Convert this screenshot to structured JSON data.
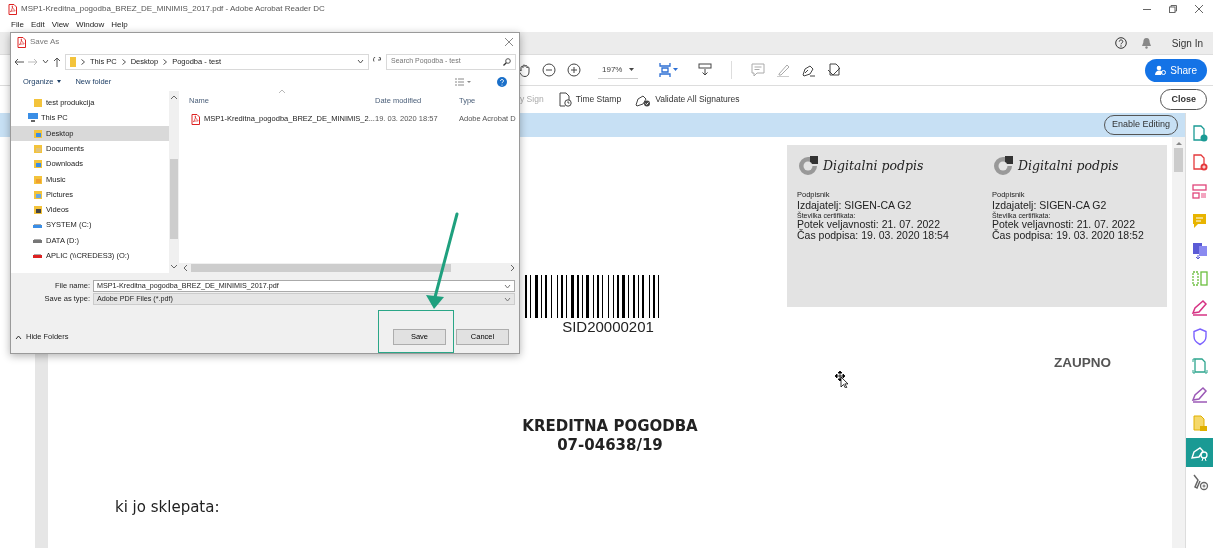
{
  "window": {
    "title": "MSP1-Kreditna_pogodba_BREZ_DE_MINIMIS_2017.pdf - Adobe Acrobat Reader DC"
  },
  "menu": [
    {
      "label": "File"
    },
    {
      "label": "Edit"
    },
    {
      "label": "View"
    },
    {
      "label": "Window"
    },
    {
      "label": "Help"
    }
  ],
  "account": {
    "sign_in": "Sign In"
  },
  "toolbar": {
    "zoom": "197%",
    "share": "Share"
  },
  "sign_toolbar": {
    "items": [
      {
        "label": "y Sign",
        "disabled": true
      },
      {
        "label": "Time Stamp",
        "disabled": false,
        "kind": "timestamp"
      },
      {
        "label": "Validate All Signatures",
        "disabled": false,
        "kind": "validate"
      }
    ],
    "close": "Close"
  },
  "notice_bar": {
    "button": "Enable Editing"
  },
  "tools_rail": [
    {
      "kind": "export",
      "selected": false
    },
    {
      "kind": "create",
      "selected": false
    },
    {
      "kind": "organize",
      "selected": false
    },
    {
      "kind": "comment",
      "selected": false
    },
    {
      "kind": "scan",
      "selected": false
    },
    {
      "kind": "compress",
      "selected": false
    },
    {
      "kind": "fill",
      "selected": false
    },
    {
      "kind": "protect",
      "selected": false
    },
    {
      "kind": "ocr",
      "selected": false
    },
    {
      "kind": "sign",
      "selected": false
    },
    {
      "kind": "send",
      "selected": false
    },
    {
      "kind": "certificate",
      "selected": true
    },
    {
      "kind": "more",
      "selected": false
    }
  ],
  "document": {
    "signatures": [
      {
        "title": "Digitalni podpis",
        "signer": "Podpisnik",
        "issuer": "Izdajatelj: SIGEN-CA G2",
        "certificate": "Številka certifikata:",
        "expiry": "Potek veljavnosti: 21. 07. 2022",
        "time": "Čas podpisa: 19. 03. 2020 18:54"
      },
      {
        "title": "Digitalni podpis",
        "signer": "Podpisnik",
        "issuer": "Izdajatelj: SIGEN-CA G2",
        "certificate": "Številka certifikata:",
        "expiry": "Potek veljavnosti: 21. 07. 2022",
        "time": "Čas podpisa: 19. 03. 2020 18:52"
      }
    ],
    "barcode_text": "SID20000201",
    "confidential": "ZAUPNO",
    "heading": [
      "KREDITNA POGODBA",
      "07-04638/19"
    ],
    "body": "ki jo sklepata:"
  },
  "dialog": {
    "title": "Save As",
    "breadcrumb": [
      "This PC",
      "Desktop",
      "Pogodba - test"
    ],
    "search": {
      "placeholder": "Search Pogodba - test"
    },
    "organize": "Organize",
    "new_folder": "New folder",
    "nav": [
      {
        "label": "test produkcija",
        "kind": "folder",
        "selected": false
      },
      {
        "label": "This PC",
        "kind": "pc",
        "selected": false,
        "children": [
          {
            "label": "Desktop",
            "kind": "desktop",
            "selected": true
          },
          {
            "label": "Documents",
            "kind": "documents",
            "selected": false
          },
          {
            "label": "Downloads",
            "kind": "downloads",
            "selected": false
          },
          {
            "label": "Music",
            "kind": "music",
            "selected": false
          },
          {
            "label": "Pictures",
            "kind": "pictures",
            "selected": false
          },
          {
            "label": "Videos",
            "kind": "videos",
            "selected": false
          },
          {
            "label": "SYSTEM (C:)",
            "kind": "system-drive",
            "selected": false
          },
          {
            "label": "DATA (D:)",
            "kind": "drive",
            "selected": false
          },
          {
            "label": "APLIC (\\\\CREDES3) (O:)",
            "kind": "network-drive",
            "selected": false
          }
        ]
      }
    ],
    "columns": [
      "Name",
      "Date modified",
      "Type"
    ],
    "rows": [
      {
        "name": "MSP1-Kreditna_pogodba_BREZ_DE_MINIMIS_2...",
        "date": "19. 03. 2020 18:57",
        "type": "Adobe Acrobat D"
      }
    ],
    "file_name_label": "File name:",
    "file_name": "MSP1-Kreditna_pogodba_BREZ_DE_MINIMIS_2017.pdf",
    "type_label": "Save as type:",
    "type": "Adobe PDF Files (*.pdf)",
    "hide_folders": "Hide Folders",
    "save": "Save",
    "cancel": "Cancel"
  }
}
